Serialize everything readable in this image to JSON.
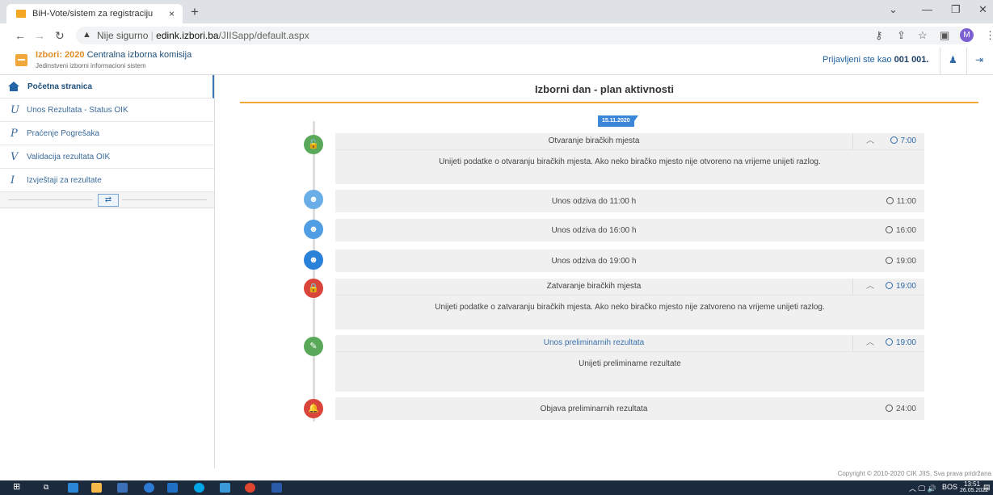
{
  "browser": {
    "tab_title": "BiH-Vote/sistem za registraciju",
    "tab_close": "×",
    "new_tab": "+",
    "url_prefix": "Nije sigurno",
    "url_domain": "edink.izbori.ba",
    "url_path": "/JIISapp/default.aspx",
    "profile_letter": "M"
  },
  "header": {
    "brand_year_label": "Izbori: 2020",
    "brand_name": "Centralna izborna komisija",
    "brand_subtitle": "Jedinstveni izborni informacioni sistem",
    "logged_in_label": "Prijavljeni ste kao",
    "logged_in_user": "001 001."
  },
  "sidebar": {
    "items": [
      {
        "letter": "",
        "label": "Početna stranica"
      },
      {
        "letter": "U",
        "label": "Unos Rezultata - Status OIK"
      },
      {
        "letter": "P",
        "label": "Praćenje Pogrešaka"
      },
      {
        "letter": "V",
        "label": "Validacija rezultata OIK"
      },
      {
        "letter": "I",
        "label": "Izvještaji za rezultate"
      }
    ]
  },
  "main": {
    "title": "Izborni dan - plan aktivnosti",
    "date": "15.11.2020",
    "events": [
      {
        "title": "Otvaranje biračkih mjesta",
        "time": "7:00",
        "body": "Unijeti podatke o otvaranju biračkih mjesta. Ako neko biračko mjesto nije otvoreno na vrijeme unijeti razlog.",
        "color": "#5aa95a",
        "icon": "unlock-icon"
      },
      {
        "title": "Unos odziva do 11:00 h",
        "time": "11:00",
        "color": "#6aaee8",
        "icon": "users-icon"
      },
      {
        "title": "Unos odziva do 16:00 h",
        "time": "16:00",
        "color": "#4f9de3",
        "icon": "users-icon"
      },
      {
        "title": "Unos odziva do 19:00 h",
        "time": "19:00",
        "color": "#2b82d9",
        "icon": "users-icon"
      },
      {
        "title": "Zatvaranje biračkih mjesta",
        "time": "19:00",
        "body": "Unijeti podatke o zatvaranju biračkih mjesta. Ako neko biračko mjesto nije zatvoreno na vrijeme unijeti razlog.",
        "color": "#d9453a",
        "icon": "lock-icon"
      },
      {
        "title": "Unos preliminarnih rezultata",
        "time": "19:00",
        "body": "Unijeti preliminarne rezultate",
        "color": "#5aa95a",
        "icon": "edit-icon"
      },
      {
        "title": "Objava preliminarnih rezultata",
        "time": "24:00",
        "color": "#d9453a",
        "icon": "bell-icon"
      }
    ]
  },
  "footer": {
    "copyright": "Copyright © 2010-2020 CIK JIIS, Sva prava pridržana"
  },
  "taskbar": {
    "lang": "BOS",
    "time": "13:51",
    "date": "26.05.2022"
  }
}
